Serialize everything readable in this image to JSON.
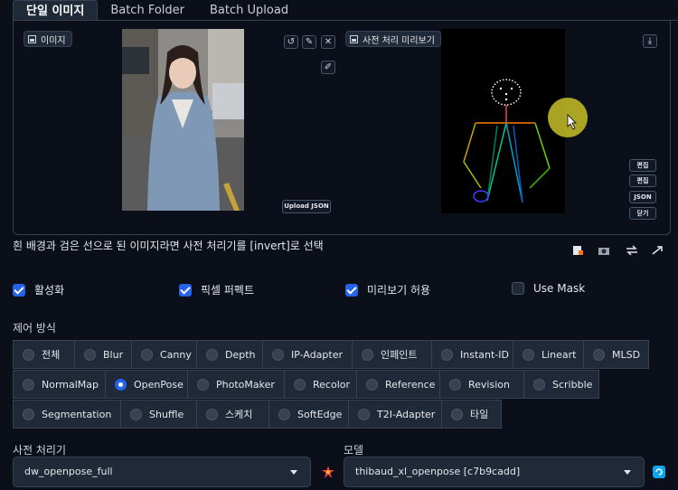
{
  "tabs": [
    "단일 이미지",
    "Batch Folder",
    "Batch Upload"
  ],
  "image_panel": {
    "label": "이미지",
    "upload_json": "Upload JSON"
  },
  "preview_panel": {
    "label": "사전 처리 미리보기",
    "side_buttons": [
      "편집",
      "편집",
      "JSON",
      "닫기"
    ]
  },
  "hint": "흰 배경과 검은 선으로 된 이미지라면 사전 처리기를 [invert]로 선택",
  "checkboxes": [
    {
      "label": "활성화",
      "checked": true
    },
    {
      "label": "픽셀 퍼펙트",
      "checked": true
    },
    {
      "label": "미리보기 허용",
      "checked": true
    },
    {
      "label": "Use Mask",
      "checked": false
    }
  ],
  "control_type": {
    "label": "제어 방식",
    "selected": "OpenPose",
    "rows": [
      [
        "전체",
        "Blur",
        "Canny",
        "Depth",
        "IP-Adapter",
        "인페인트",
        "Instant-ID",
        "Lineart",
        "MLSD"
      ],
      [
        "NormalMap",
        "OpenPose",
        "PhotoMaker",
        "Recolor",
        "Reference",
        "Revision",
        "Scribble"
      ],
      [
        "Segmentation",
        "Shuffle",
        "스케치",
        "SoftEdge",
        "T2I-Adapter",
        "타일"
      ]
    ]
  },
  "preprocessor": {
    "label": "사전 처리기",
    "value": "dw_openpose_full"
  },
  "model": {
    "label": "모델",
    "value": "thibaud_xl_openpose [c7b9cadd]"
  },
  "colors": {
    "accent": "#2563eb",
    "background": "#0b0f19",
    "surface": "#1f2937"
  }
}
